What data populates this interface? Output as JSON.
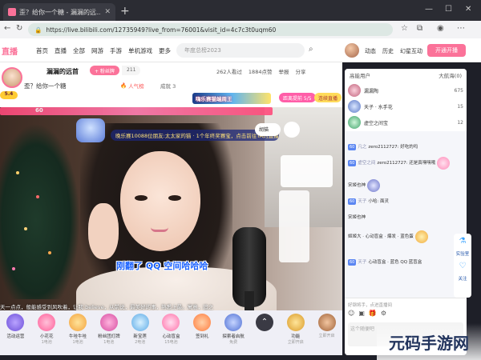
{
  "browser": {
    "tab_title": "歪？给你一个糖 - 漏漏的远...",
    "tab_close": "✕",
    "new_tab": "+",
    "minimize": "—",
    "maximize": "☐",
    "close": "✕",
    "url": "https://live.bilibili.com/12735949?live_from=76001&visit_id=4c7c3t0uqm60"
  },
  "topnav": {
    "logo": "直播",
    "links": [
      "首页",
      "直播",
      "全部",
      "网游",
      "手游",
      "单机游戏",
      "更多"
    ],
    "search_placeholder": "年度总榜2023",
    "right_links": [
      "动态",
      "历史",
      "幻星互动"
    ],
    "open_live": "开通开播"
  },
  "room": {
    "streamer_name": "漏漏的远首",
    "follow_label": "+ 粉丝牌",
    "follow_count": "211",
    "level": "5.4",
    "title": "歪？给你一个糖",
    "hot_label": "人气榜",
    "achv_label": "成就 3",
    "stats": [
      "262人看过",
      "1884点赞",
      "举报",
      "分享"
    ],
    "event_banner": "嗨乐赛猫端周王",
    "event_tag1": "距离提前 5/5",
    "event_tag2": "连续直播",
    "light_bar_num": "60",
    "gift_banner": "晚乐赛10088位朋友:太太家的猫 · 1个年终奖赛宝，点击前往TA的直播间",
    "right_pill": "胡猫",
    "subtitle": "刚翻了 QQ 空间哈哈哈",
    "danmaku": "天一点点，般能感受到风吹着，让我 believe，从前说，最美好的事，熟悉上最。寓意，追之"
  },
  "gifts": [
    {
      "label": "小花花",
      "sub": "1电池"
    },
    {
      "label": "牛哇牛哇",
      "sub": "1电池"
    },
    {
      "label": "粉丝团灯牌",
      "sub": "1电池"
    },
    {
      "label": "新宝莲",
      "sub": "2电池"
    },
    {
      "label": "心动盲盒",
      "sub": "15电池"
    },
    {
      "label": "签到礼",
      "sub": ""
    },
    {
      "label": "探索者启航",
      "sub": "免费"
    },
    {
      "label": "",
      "sub": ""
    },
    {
      "label": "功能",
      "sub": "立即开启"
    },
    {
      "label": "",
      "sub": "立即开启"
    }
  ],
  "giftsbar_left": "活动运营",
  "chat": {
    "tab1": "高能用户",
    "tab2": "大航海(0)",
    "rank": [
      {
        "name": "漏漏陶",
        "score": "675"
      },
      {
        "name": "天子 · 水手花",
        "score": "15"
      },
      {
        "name": "虚空之间宝",
        "score": "12"
      }
    ],
    "messages": [
      {
        "badge": "60",
        "user": "凡之",
        "text": "zero2112727: 好吃的吗"
      },
      {
        "badge": "60",
        "user": "虚空之间",
        "text": "zero2112727: 还是真嘿嘿哦"
      },
      {
        "badge": "",
        "user": "",
        "text": "宋姬也神"
      },
      {
        "badge": "60",
        "user": "天子",
        "text": "小哈: 面灵"
      },
      {
        "badge": "",
        "user": "",
        "text": "宋姬也神"
      },
      {
        "badge": "",
        "user": "",
        "text": "姬姬大 · 心动盲盒 · 爆发 · 蓝色蛋"
      },
      {
        "badge": "60",
        "user": "天子",
        "text": "心动盲盒 · 蓝色 QQ 蓝盲盒"
      }
    ],
    "input_hint": "好钢将手，点进直播间",
    "textbox_placeholder": "这个随便吧"
  },
  "floating": [
    "实验室",
    "关注"
  ],
  "watermark": "元码手游网"
}
